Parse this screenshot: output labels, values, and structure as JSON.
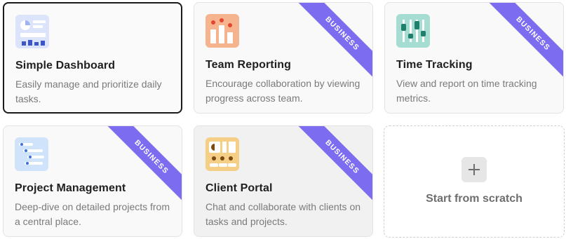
{
  "templates": [
    {
      "id": "simple-dashboard",
      "title": "Simple Dashboard",
      "description": "Easily manage and prioritize daily tasks.",
      "badge": "",
      "icon": "dashboard-icon",
      "selected": true
    },
    {
      "id": "team-reporting",
      "title": "Team Reporting",
      "description": "Encourage collaboration by viewing progress across team.",
      "badge": "BUSINESS",
      "icon": "team-reporting-icon"
    },
    {
      "id": "time-tracking",
      "title": "Time Tracking",
      "description": "View and report on time tracking metrics.",
      "badge": "BUSINESS",
      "icon": "time-tracking-icon"
    },
    {
      "id": "project-management",
      "title": "Project Management",
      "description": "Deep-dive on detailed projects from a central place.",
      "badge": "BUSINESS",
      "icon": "project-management-icon"
    },
    {
      "id": "client-portal",
      "title": "Client Portal",
      "description": "Chat and collaborate with clients on tasks and projects.",
      "badge": "BUSINESS",
      "icon": "client-portal-icon",
      "hovered": true
    }
  ],
  "scratch": {
    "label": "Start from scratch",
    "icon": "plus-icon"
  },
  "colors": {
    "badge": "#7c6df0",
    "selected_border": "#1a1a1a"
  }
}
